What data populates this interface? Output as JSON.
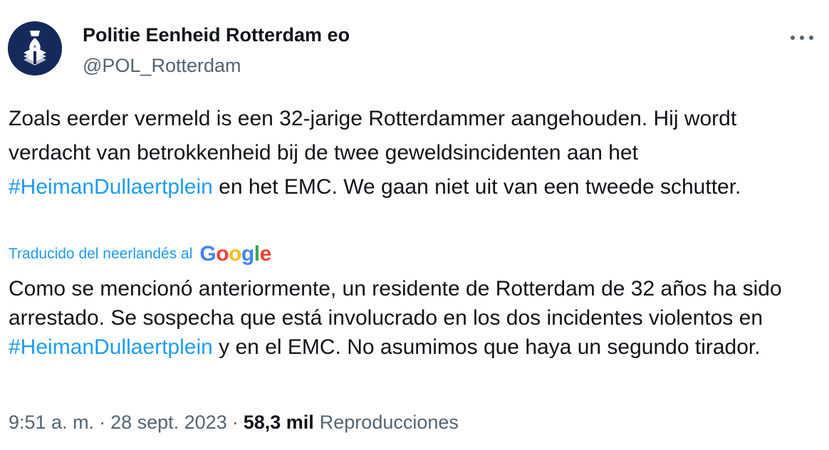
{
  "author": {
    "name": "Politie Eenheid Rotterdam eo",
    "handle": "@POL_Rotterdam"
  },
  "tweet": {
    "original_parts": [
      "Zoals eerder vermeld is een 32-jarige Rotterdammer aangehouden. Hij wordt verdacht van betrokkenheid bij de twee geweldsincidenten aan het ",
      "#HeimanDullaertplein",
      " en het EMC. We gaan niet uit van een tweede schutter."
    ],
    "translated_by": "Traducido del neerlandés al",
    "translator_logo_letters": [
      "G",
      "o",
      "o",
      "g",
      "l",
      "e"
    ],
    "translation_parts": [
      "Como se mencionó anteriormente, un residente de Rotterdam de 32 años ha sido arrestado. Se sospecha que está involucrado en los dos incidentes violentos en ",
      "#HeimanDullaertplein",
      " y en el EMC. No asumimos que haya un segundo tirador."
    ]
  },
  "meta": {
    "time": "9:51 a. m.",
    "separator": "·",
    "date": "28 sept. 2023",
    "views_count": "58,3 mil",
    "views_label": "Reproducciones"
  },
  "icons": {
    "avatar": "police-emblem-icon",
    "more": "more-horizontal-icon"
  },
  "colors": {
    "link": "#1d9bf0",
    "secondary_text": "#536471",
    "primary_text": "#0f1419",
    "avatar_bg": "#15295b",
    "google_blue": "#4285f4",
    "google_red": "#ea4335",
    "google_yellow": "#fbbc05",
    "google_green": "#34a853"
  }
}
